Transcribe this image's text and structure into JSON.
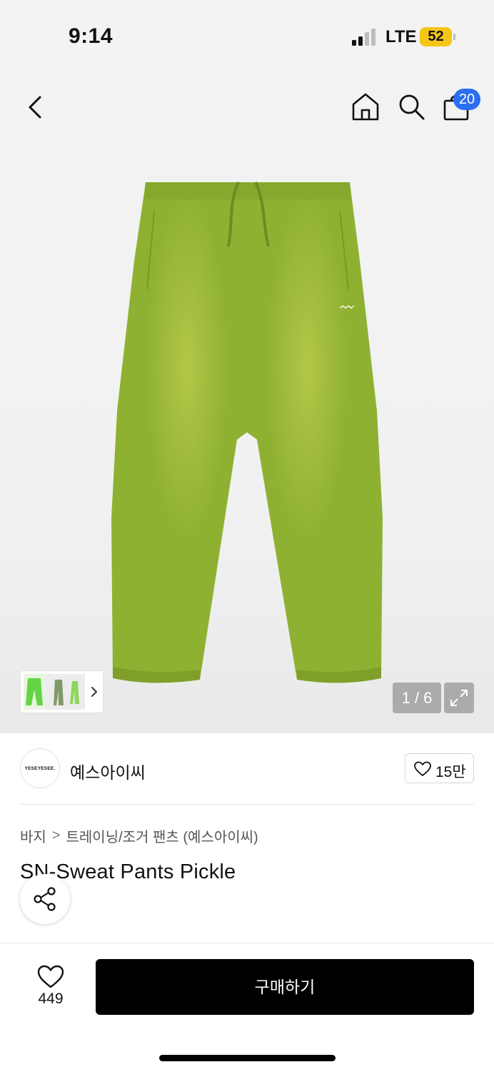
{
  "status_bar": {
    "time": "9:14",
    "network": "LTE",
    "battery": "52"
  },
  "nav": {
    "cart_count": "20"
  },
  "gallery": {
    "page_counter": "1 / 6"
  },
  "brand": {
    "logo_text": "YESEYESEE.",
    "name": "예스아이씨",
    "likes": "15만"
  },
  "breadcrumb": {
    "category": "바지",
    "separator": ">",
    "subcategory": "트레이닝/조거 팬츠 (예스아이씨)"
  },
  "product": {
    "title": "SN-Sweat Pants Pickle"
  },
  "bottom_bar": {
    "wish_count": "449",
    "buy_label": "구매하기"
  },
  "colors": {
    "accent_badge": "#2b6ef2",
    "battery": "#f5c518",
    "buy_button": "#000000",
    "pants": "#8fb132"
  }
}
